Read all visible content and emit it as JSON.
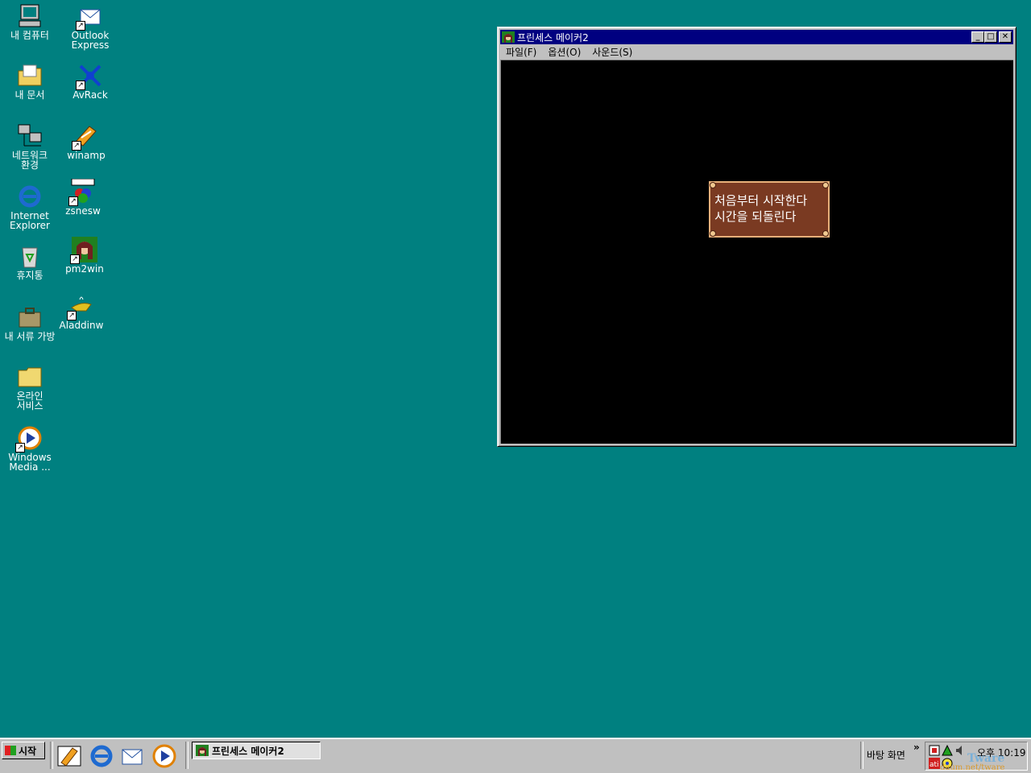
{
  "desktop": {
    "icons": [
      {
        "label": "내 컴퓨터",
        "icon": "my-computer-icon"
      },
      {
        "label": "Outlook Express",
        "icon": "outlook-express-icon"
      },
      {
        "label": "내 문서",
        "icon": "my-documents-icon"
      },
      {
        "label": "AvRack",
        "icon": "avrack-icon"
      },
      {
        "label": "네트워크 환경",
        "icon": "network-icon"
      },
      {
        "label": "winamp",
        "icon": "winamp-icon"
      },
      {
        "label": "Internet Explorer",
        "icon": "internet-explorer-icon"
      },
      {
        "label": "zsnesw",
        "icon": "zsnes-icon"
      },
      {
        "label": "휴지통",
        "icon": "recycle-bin-icon"
      },
      {
        "label": "pm2win",
        "icon": "pm2win-icon"
      },
      {
        "label": "내 서류 가방",
        "icon": "briefcase-icon"
      },
      {
        "label": "Aladdinw",
        "icon": "aladdin-lamp-icon"
      },
      {
        "label": "온라인 서비스",
        "icon": "folder-icon"
      },
      {
        "label": "Windows Media ...",
        "icon": "windows-media-icon"
      }
    ]
  },
  "window": {
    "title": "프린세스 메이커2",
    "menu": {
      "file": "파일(F)",
      "options": "옵션(O)",
      "sound": "사운드(S)"
    },
    "dialog": {
      "line1": "처음부터 시작한다",
      "line2": "시간을 되돌린다"
    },
    "controls": {
      "minimize": "_",
      "maximize": "□",
      "close": "✕"
    }
  },
  "taskbar": {
    "start_label": "시작",
    "task_title": "프린세스 메이커2",
    "desktop_label": "바탕 화면",
    "chevron": "»",
    "clock": "오후 10:19",
    "watermark_main": "Tware",
    "watermark_url": "daum.net/tware"
  },
  "colors": {
    "desktop": "#008080",
    "titlebar": "#000080",
    "dialog_bg": "#7a3a22",
    "dialog_border": "#e8b07a"
  }
}
